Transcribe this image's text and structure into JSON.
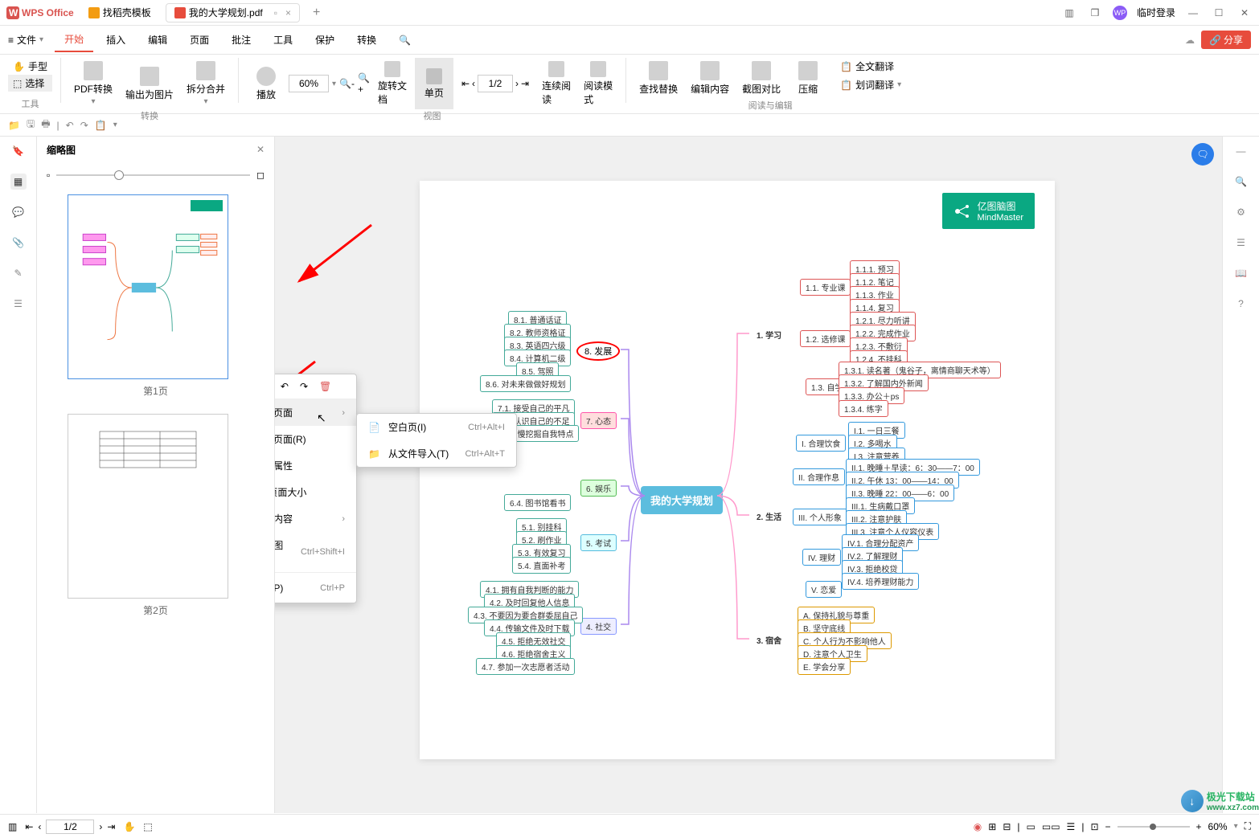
{
  "titlebar": {
    "app": "WPS Office",
    "tabs": [
      {
        "label": "找稻壳模板",
        "icon": "orange"
      },
      {
        "label": "我的大学规划.pdf",
        "icon": "red",
        "active": true
      }
    ],
    "login": "临时登录"
  },
  "menubar": {
    "file": "文件",
    "items": [
      "开始",
      "插入",
      "编辑",
      "页面",
      "批注",
      "工具",
      "保护",
      "转换"
    ]
  },
  "ribbon": {
    "hand": "手型",
    "select": "选择",
    "pdf_convert": "PDF转换",
    "export_img": "输出为图片",
    "split_merge": "拆分合并",
    "play": "播放",
    "zoom": "60%",
    "rotate": "旋转文档",
    "single": "单页",
    "continuous": "连续阅读",
    "read_mode": "阅读模式",
    "find": "查找替换",
    "edit_content": "编辑内容",
    "crop": "截图对比",
    "compress": "压缩",
    "full_trans": "全文翻译",
    "word_trans": "划词翻译",
    "groups": {
      "g1": "工具",
      "g2": "转换",
      "g3": "视图",
      "g4": "阅读与编辑"
    }
  },
  "thumb_panel": {
    "title": "缩略图",
    "pages": [
      "第1页",
      "第2页"
    ]
  },
  "context_menu": {
    "items": [
      {
        "label": "插入页面",
        "sub": true
      },
      {
        "label": "替换页面(R)"
      },
      {
        "label": "页面属性"
      },
      {
        "label": "调整页面大小"
      },
      {
        "label": "提取内容",
        "sub": true
      },
      {
        "label": "转为图片",
        "shortcut": "Ctrl+Shift+I"
      },
      {
        "label": "打印(P)",
        "shortcut": "Ctrl+P"
      }
    ],
    "submenu": [
      {
        "label": "空白页(I)",
        "shortcut": "Ctrl+Alt+I"
      },
      {
        "label": "从文件导入(T)",
        "shortcut": "Ctrl+Alt+T"
      }
    ]
  },
  "page_content": {
    "logo": {
      "l1": "亿图脑图",
      "l2": "MindMaster"
    },
    "center": "我的大学规划",
    "b8": {
      "title": "8. 发展",
      "items": [
        "8.1. 普通话证",
        "8.2. 教师资格证",
        "8.3. 英语四六级",
        "8.4. 计算机二级",
        "8.5. 驾照",
        "8.6. 对未来做做好规划"
      ]
    },
    "b7": {
      "title": "7. 心态",
      "items": [
        "7.1. 接受自己的平凡",
        "7.2. 认识自己的不足",
        "7.3. 慢慢挖掘自我特点"
      ]
    },
    "b6": {
      "title": "6. 娱乐",
      "items": [
        "6.4. 图书馆看书"
      ]
    },
    "b5": {
      "title": "5. 考试",
      "items": [
        "5.1. 别挂科",
        "5.2. 刷作业",
        "5.3. 有效复习",
        "5.4. 直面补考"
      ]
    },
    "b4": {
      "title": "4. 社交",
      "items": [
        "4.1. 拥有自我判断的能力",
        "4.2. 及时回复他人信息",
        "4.3. 不要因为要合群委屈自己",
        "4.4. 传输文件及时下载",
        "4.5. 拒绝无效社交",
        "4.6. 拒绝宿舍主义",
        "4.7. 参加一次志愿者活动"
      ]
    },
    "b1": {
      "title": "1. 学习",
      "subs": [
        "1.1. 专业课",
        "1.2. 选修课",
        "1.3. 自学"
      ],
      "i11": [
        "1.1.1. 预习",
        "1.1.2. 笔记",
        "1.1.3. 作业",
        "1.1.4. 复习"
      ],
      "i12": [
        "1.2.1. 尽力听讲",
        "1.2.2. 完成作业",
        "1.2.3. 不敷衍",
        "1.2.4. 不挂科"
      ],
      "i13": [
        "1.3.1. 读名著（鬼谷子，离情商聊天术等）",
        "1.3.2. 了解国内外新闻",
        "1.3.3. 办公＋ps",
        "1.3.4. 练字"
      ]
    },
    "b2": {
      "title": "2. 生活",
      "subs": [
        "I. 合理饮食",
        "II. 合理作息",
        "III. 个人形象",
        "IV. 理财",
        "V. 恋爱"
      ],
      "i1": [
        "I.1. 一日三餐",
        "I.2. 多喝水",
        "I.3. 注意营养"
      ],
      "i2": [
        "II.1. 晚睡＋早读：6：30——7：00",
        "II.2. 午休 13：00——14：00",
        "II.3. 晚睡 22：00——6：00"
      ],
      "i3": [
        "III.1. 生病戴口罩",
        "III.2. 注意护肤",
        "III.3. 注意个人仪容仪表"
      ],
      "i4": [
        "IV.1. 合理分配资产",
        "IV.2. 了解理财",
        "IV.3. 拒绝校贷",
        "IV.4. 培养理财能力"
      ]
    },
    "b3": {
      "title": "3. 宿舍",
      "items": [
        "A. 保持礼貌与尊重",
        "B. 坚守底线",
        "C. 个人行为不影响他人",
        "D. 注意个人卫生",
        "E. 学会分享"
      ]
    }
  },
  "status": {
    "page": "1/2",
    "page_field": "1/2",
    "zoom": "60%"
  },
  "share": "分享",
  "watermark": {
    "text": "极光下载站",
    "url": "www.xz7.com"
  }
}
